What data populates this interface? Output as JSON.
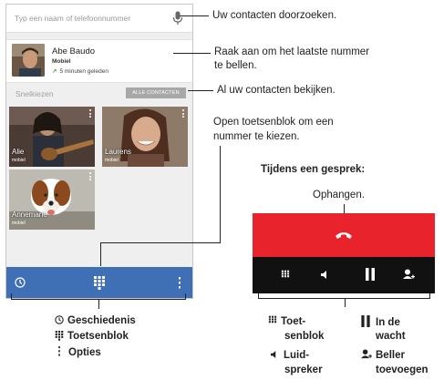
{
  "phone": {
    "search_placeholder": "Typ een naam of telefoonnummer",
    "recent": {
      "name": "Abe Baudo",
      "type": "Mobiel",
      "time": "5 minuten geleden"
    },
    "speed_dial_label": "Snelkiezen",
    "all_contacts_button": "ALLE CONTACTEN",
    "favorites": [
      {
        "name": "Alie",
        "type": "mobiel"
      },
      {
        "name": "Laurens",
        "type": "mobiel"
      },
      {
        "name": "Annemarie",
        "type": "mobiel"
      }
    ]
  },
  "callouts": {
    "search": "Uw contacten doorzoeken.",
    "redial_line1": "Raak aan om het laatste nummer",
    "redial_line2": "te bellen.",
    "all_contacts": "Al uw contacten bekijken.",
    "dialpad_line1": "Open toetsenblok om een",
    "dialpad_line2": "nummer te kiezen."
  },
  "call_panel": {
    "heading": "Tijdens een gesprek:",
    "hangup": "Ophangen."
  },
  "legend_left": {
    "history": "Geschiedenis",
    "dialpad": "Toetsenblok",
    "options": "Opties"
  },
  "legend_right": {
    "dialpad_line1": "Toet-",
    "dialpad_line2": "senblok",
    "hold_line1": "In de",
    "hold_line2": "wacht",
    "speaker_line1": "Luid-",
    "speaker_line2": "spreker",
    "add_line1": "Beller",
    "add_line2": "toevoegen"
  },
  "colors": {
    "blue_bar": "#3f6fb5",
    "red_panel": "#e8232b",
    "black_panel": "#111111",
    "recent_arrow": "#4caf50"
  }
}
